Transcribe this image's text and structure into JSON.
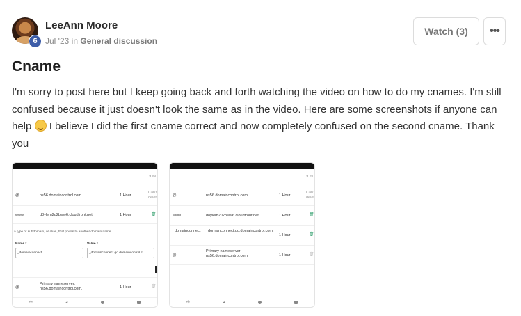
{
  "post": {
    "author": "LeeAnn Moore",
    "badge": "6",
    "date": "Jul '23",
    "in_text": " in ",
    "category": "General discussion",
    "watch_label": "Watch (3)",
    "more_icon": "ellipsis-icon",
    "title": "Cname",
    "body_part1": "I'm sorry to post here but I keep going back and forth watching the video on how to do my cnames. I'm still confused because it just doesn't look the same as in the video. Here are some screenshots if anyone can help ",
    "body_part2": " I believe I did the first cname correct and now completely confused on the second cname. Thank you"
  },
  "screenshot1": {
    "filter": "▼ Fil",
    "rows": [
      {
        "type": "@",
        "value": "ns56.domaincontrol.com.",
        "ttl": "1 Hour",
        "extra": "Can't\ndelete"
      },
      {
        "type": "www",
        "value": "d8ylem2u2bww6.cloudfront.net.",
        "ttl": "1 Hour"
      }
    ],
    "hint": "a type of subdomain, or alias, that points to another domain name.",
    "name_label": "Name *",
    "value_label": "Value *",
    "name_value": "_domainconnect",
    "value_value": "_domainconnect.gd.domaincontrol.c",
    "last_row": {
      "type": "@",
      "value": "Primary nameserver: ns56.domaincontrol.com.",
      "ttl": "1 Hour"
    }
  },
  "screenshot2": {
    "filter": "▼ Fil",
    "rows": [
      {
        "type": "@",
        "value": "ns56.domaincontrol.com.",
        "ttl": "1 Hour",
        "extra": "Can't\ndelet"
      },
      {
        "type": "www",
        "value": "d8ylem2u2bww6.cloudfront.net.",
        "ttl": "1 Hour"
      },
      {
        "type": "_domainconnect",
        "value": "_domainconnect.gd.domaincontrol.com.",
        "ttl": "1 Hour"
      },
      {
        "type": "@",
        "value": "Primary nameserver: ns56.domaincontrol.com.",
        "ttl": "1 Hour"
      }
    ]
  },
  "navbar": {
    "back": "◂",
    "recent": "✣"
  }
}
